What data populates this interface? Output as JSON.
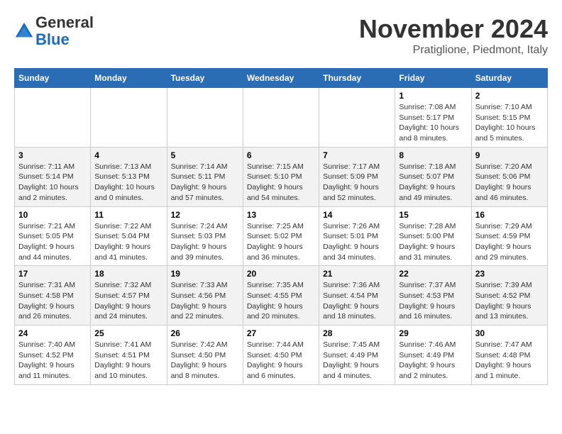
{
  "logo": {
    "general": "General",
    "blue": "Blue"
  },
  "title": "November 2024",
  "location": "Pratiglione, Piedmont, Italy",
  "days_of_week": [
    "Sunday",
    "Monday",
    "Tuesday",
    "Wednesday",
    "Thursday",
    "Friday",
    "Saturday"
  ],
  "weeks": [
    [
      {
        "day": "",
        "info": ""
      },
      {
        "day": "",
        "info": ""
      },
      {
        "day": "",
        "info": ""
      },
      {
        "day": "",
        "info": ""
      },
      {
        "day": "",
        "info": ""
      },
      {
        "day": "1",
        "info": "Sunrise: 7:08 AM\nSunset: 5:17 PM\nDaylight: 10 hours and 8 minutes."
      },
      {
        "day": "2",
        "info": "Sunrise: 7:10 AM\nSunset: 5:15 PM\nDaylight: 10 hours and 5 minutes."
      }
    ],
    [
      {
        "day": "3",
        "info": "Sunrise: 7:11 AM\nSunset: 5:14 PM\nDaylight: 10 hours and 2 minutes."
      },
      {
        "day": "4",
        "info": "Sunrise: 7:13 AM\nSunset: 5:13 PM\nDaylight: 10 hours and 0 minutes."
      },
      {
        "day": "5",
        "info": "Sunrise: 7:14 AM\nSunset: 5:11 PM\nDaylight: 9 hours and 57 minutes."
      },
      {
        "day": "6",
        "info": "Sunrise: 7:15 AM\nSunset: 5:10 PM\nDaylight: 9 hours and 54 minutes."
      },
      {
        "day": "7",
        "info": "Sunrise: 7:17 AM\nSunset: 5:09 PM\nDaylight: 9 hours and 52 minutes."
      },
      {
        "day": "8",
        "info": "Sunrise: 7:18 AM\nSunset: 5:07 PM\nDaylight: 9 hours and 49 minutes."
      },
      {
        "day": "9",
        "info": "Sunrise: 7:20 AM\nSunset: 5:06 PM\nDaylight: 9 hours and 46 minutes."
      }
    ],
    [
      {
        "day": "10",
        "info": "Sunrise: 7:21 AM\nSunset: 5:05 PM\nDaylight: 9 hours and 44 minutes."
      },
      {
        "day": "11",
        "info": "Sunrise: 7:22 AM\nSunset: 5:04 PM\nDaylight: 9 hours and 41 minutes."
      },
      {
        "day": "12",
        "info": "Sunrise: 7:24 AM\nSunset: 5:03 PM\nDaylight: 9 hours and 39 minutes."
      },
      {
        "day": "13",
        "info": "Sunrise: 7:25 AM\nSunset: 5:02 PM\nDaylight: 9 hours and 36 minutes."
      },
      {
        "day": "14",
        "info": "Sunrise: 7:26 AM\nSunset: 5:01 PM\nDaylight: 9 hours and 34 minutes."
      },
      {
        "day": "15",
        "info": "Sunrise: 7:28 AM\nSunset: 5:00 PM\nDaylight: 9 hours and 31 minutes."
      },
      {
        "day": "16",
        "info": "Sunrise: 7:29 AM\nSunset: 4:59 PM\nDaylight: 9 hours and 29 minutes."
      }
    ],
    [
      {
        "day": "17",
        "info": "Sunrise: 7:31 AM\nSunset: 4:58 PM\nDaylight: 9 hours and 26 minutes."
      },
      {
        "day": "18",
        "info": "Sunrise: 7:32 AM\nSunset: 4:57 PM\nDaylight: 9 hours and 24 minutes."
      },
      {
        "day": "19",
        "info": "Sunrise: 7:33 AM\nSunset: 4:56 PM\nDaylight: 9 hours and 22 minutes."
      },
      {
        "day": "20",
        "info": "Sunrise: 7:35 AM\nSunset: 4:55 PM\nDaylight: 9 hours and 20 minutes."
      },
      {
        "day": "21",
        "info": "Sunrise: 7:36 AM\nSunset: 4:54 PM\nDaylight: 9 hours and 18 minutes."
      },
      {
        "day": "22",
        "info": "Sunrise: 7:37 AM\nSunset: 4:53 PM\nDaylight: 9 hours and 16 minutes."
      },
      {
        "day": "23",
        "info": "Sunrise: 7:39 AM\nSunset: 4:52 PM\nDaylight: 9 hours and 13 minutes."
      }
    ],
    [
      {
        "day": "24",
        "info": "Sunrise: 7:40 AM\nSunset: 4:52 PM\nDaylight: 9 hours and 11 minutes."
      },
      {
        "day": "25",
        "info": "Sunrise: 7:41 AM\nSunset: 4:51 PM\nDaylight: 9 hours and 10 minutes."
      },
      {
        "day": "26",
        "info": "Sunrise: 7:42 AM\nSunset: 4:50 PM\nDaylight: 9 hours and 8 minutes."
      },
      {
        "day": "27",
        "info": "Sunrise: 7:44 AM\nSunset: 4:50 PM\nDaylight: 9 hours and 6 minutes."
      },
      {
        "day": "28",
        "info": "Sunrise: 7:45 AM\nSunset: 4:49 PM\nDaylight: 9 hours and 4 minutes."
      },
      {
        "day": "29",
        "info": "Sunrise: 7:46 AM\nSunset: 4:49 PM\nDaylight: 9 hours and 2 minutes."
      },
      {
        "day": "30",
        "info": "Sunrise: 7:47 AM\nSunset: 4:48 PM\nDaylight: 9 hours and 1 minute."
      }
    ]
  ]
}
